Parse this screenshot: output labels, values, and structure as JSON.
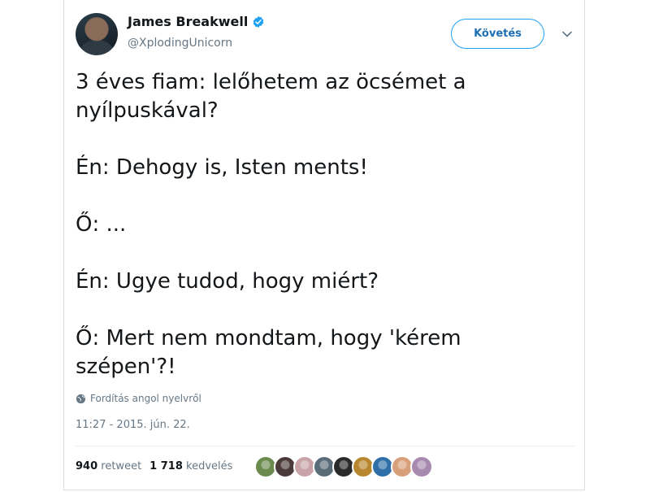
{
  "user": {
    "name": "James Breakwell",
    "handle": "@XplodingUnicorn"
  },
  "follow_button": {
    "label": "Követés"
  },
  "tweet": {
    "text": "3 éves fiam: lelőhetem az öcsémet a\nnyílpuskával?\n\nÉn: Dehogy is, Isten ments!\n\nŐ: ...\n\nÉn: Ugye tudod, hogy miért?\n\nŐ: Mert nem mondtam, hogy 'kérem\nszépen'?!"
  },
  "translate": {
    "label": "Fordítás angol nyelvről",
    "icon": "globe-icon"
  },
  "timestamp": "11:27 - 2015. jún. 22.",
  "stats": {
    "retweets_count": "940",
    "retweets_label": "retweet",
    "likes_count": "1 718",
    "likes_label": "kedvelés"
  },
  "likers": [
    {
      "color": "#6b8a4e"
    },
    {
      "color": "#4a3a3a"
    },
    {
      "color": "#c9a3a8"
    },
    {
      "color": "#5a6c78"
    },
    {
      "color": "#2a2a2a"
    },
    {
      "color": "#b8862e"
    },
    {
      "color": "#2f6fa8"
    },
    {
      "color": "#d8a07a"
    },
    {
      "color": "#a88ab0"
    }
  ],
  "colors": {
    "accent": "#1da1f2",
    "verified": "#1da1f2",
    "muted_text": "#657786"
  }
}
